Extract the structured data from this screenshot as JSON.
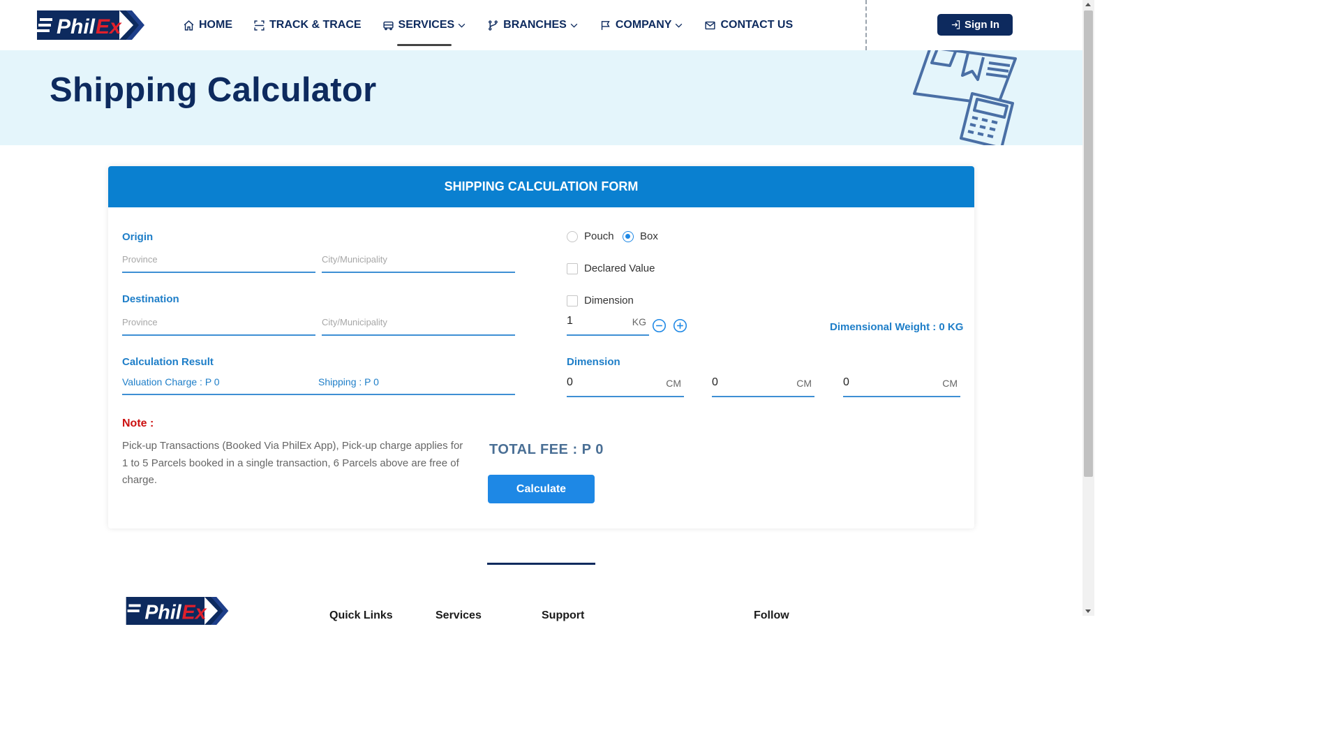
{
  "brand": {
    "name": "PhilEx",
    "navy": "#0d2a5e",
    "accent_blue": "#1e88e5",
    "header_blue": "#0a80d0",
    "red": "#cc1111",
    "banner_bg": "#e4f5fb"
  },
  "nav": {
    "items": [
      {
        "label": "HOME",
        "icon": "home-icon",
        "dropdown": false
      },
      {
        "label": "TRACK & TRACE",
        "icon": "scan-icon",
        "dropdown": false
      },
      {
        "label": "SERVICES",
        "icon": "truck-icon",
        "dropdown": true,
        "active": true
      },
      {
        "label": "BRANCHES",
        "icon": "branch-icon",
        "dropdown": true
      },
      {
        "label": "COMPANY",
        "icon": "flag-icon",
        "dropdown": true
      },
      {
        "label": "CONTACT US",
        "icon": "mail-icon",
        "dropdown": false
      }
    ],
    "signin_label": "Sign In"
  },
  "banner": {
    "title": "Shipping Calculator",
    "illustration": "package-calculator-icon"
  },
  "form": {
    "header": "SHIPPING CALCULATION FORM",
    "origin": {
      "label": "Origin",
      "province_placeholder": "Province",
      "city_placeholder": "City/Municipality"
    },
    "destination": {
      "label": "Destination",
      "province_placeholder": "Province",
      "city_placeholder": "City/Municipality"
    },
    "result": {
      "label": "Calculation Result",
      "valuation": "Valuation Charge : P 0",
      "shipping": "Shipping : P 0"
    },
    "package_type": {
      "options": [
        "Pouch",
        "Box"
      ],
      "selected": "Box"
    },
    "declared_value": {
      "label": "Declared Value",
      "checked": false
    },
    "dimension_toggle": {
      "label": "Dimension",
      "checked": false
    },
    "weight": {
      "value": "1",
      "unit": "KG"
    },
    "dimensional_weight": "Dimensional Weight : 0 KG",
    "dimension": {
      "label": "Dimension",
      "fields": [
        {
          "value": "0",
          "unit": "CM"
        },
        {
          "value": "0",
          "unit": "CM"
        },
        {
          "value": "0",
          "unit": "CM"
        }
      ]
    },
    "note": {
      "title": "Note :",
      "text": "Pick-up Transactions (Booked Via PhilEx App), Pick-up charge applies for 1 to 5 Parcels booked in a single transaction, 6 Parcels above are free of charge."
    },
    "total_fee": "TOTAL FEE : P 0",
    "calculate_label": "Calculate"
  },
  "footer": {
    "columns": [
      "Quick Links",
      "Services",
      "Support",
      "Follow"
    ]
  }
}
